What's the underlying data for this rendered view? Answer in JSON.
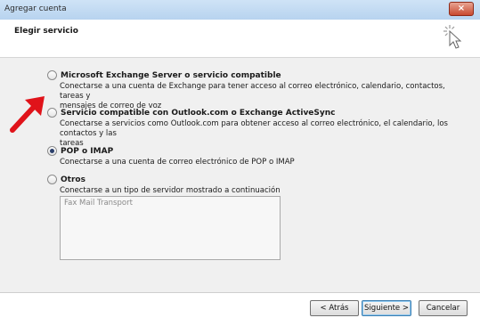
{
  "window": {
    "title": "Agregar cuenta",
    "close_icon": "×"
  },
  "header": {
    "title": "Elegir servicio"
  },
  "options": [
    {
      "label": "Microsoft Exchange Server o servicio compatible",
      "desc1": "Conectarse a una cuenta de Exchange para tener acceso al correo electrónico, calendario, contactos, tareas y",
      "desc2": "mensajes de correo de voz",
      "selected": false
    },
    {
      "label": "Servicio compatible con Outlook.com o Exchange ActiveSync",
      "desc1": "Conectarse a servicios como Outlook.com para obtener acceso al correo electrónico, el calendario, los contactos y las",
      "desc2": "tareas",
      "selected": false
    },
    {
      "label": "POP o IMAP",
      "desc1": "Conectarse a una cuenta de correo electrónico de POP o IMAP",
      "selected": true
    },
    {
      "label": "Otros",
      "desc1": "Conectarse a un tipo de servidor mostrado a continuación",
      "selected": false
    }
  ],
  "other_list": {
    "items": [
      "Fax Mail Transport"
    ]
  },
  "buttons": {
    "back": "< Atrás",
    "next": "Siguiente >",
    "cancel": "Cancelar"
  },
  "colors": {
    "arrow": "#e0131a",
    "titlebar": "#c4dcf2",
    "content_bg": "#f0f0f0"
  },
  "icons": {
    "wizard": "cursor-click-icon",
    "arrow": "red-arrow-annotation"
  }
}
